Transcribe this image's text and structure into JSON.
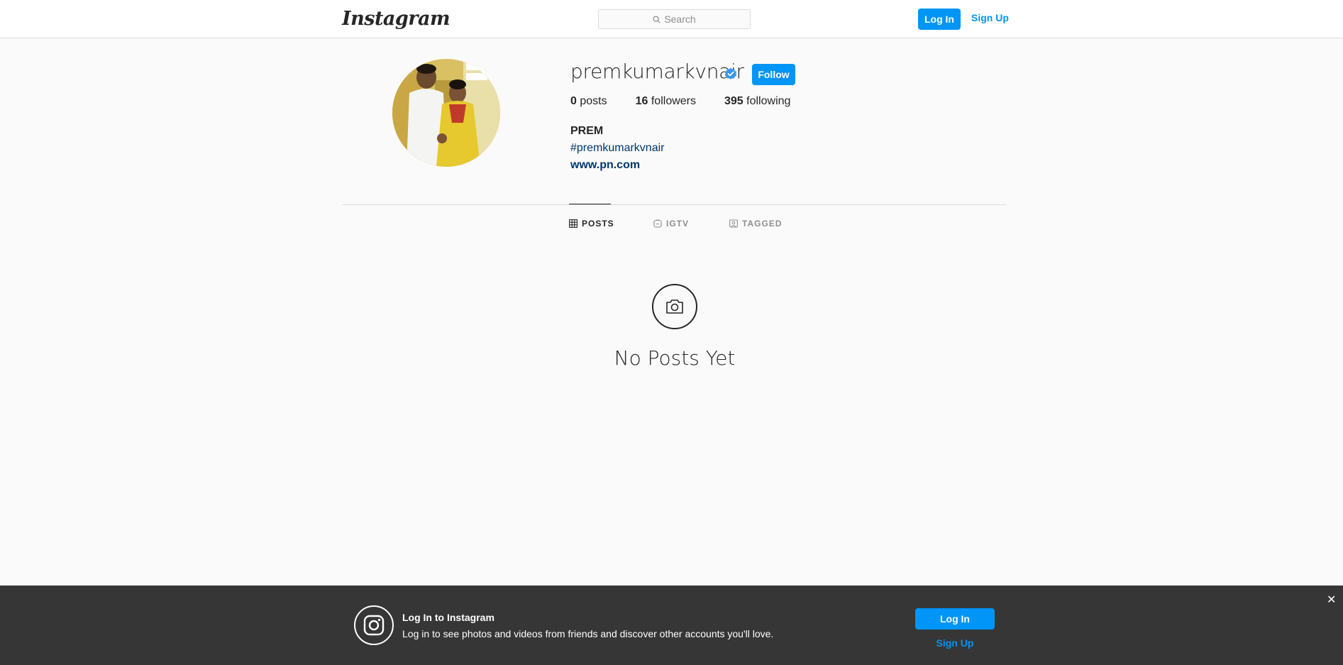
{
  "header": {
    "logo_text": "Instagram",
    "search_placeholder": "Search",
    "login_label": "Log In",
    "signup_label": "Sign Up"
  },
  "profile": {
    "username": "premkumarkvnair",
    "verified": true,
    "follow_label": "Follow",
    "stats": {
      "posts_count": "0",
      "posts_label": "posts",
      "followers_count": "16",
      "followers_label": "followers",
      "following_count": "395",
      "following_label": "following"
    },
    "full_name": "PREM",
    "bio_hashtag": "#premkumarkvnair",
    "website": "www.pn.com"
  },
  "tabs": [
    {
      "label": "POSTS",
      "icon": "grid-icon",
      "active": true
    },
    {
      "label": "IGTV",
      "icon": "igtv-icon",
      "active": false
    },
    {
      "label": "TAGGED",
      "icon": "tagged-icon",
      "active": false
    }
  ],
  "empty_state": {
    "icon": "camera-icon",
    "message": "No Posts Yet"
  },
  "login_banner": {
    "title": "Log In to Instagram",
    "text": "Log in to see photos and videos from friends and discover other accounts you'll love.",
    "login_label": "Log In",
    "signup_label": "Sign Up",
    "close_symbol": "✕"
  },
  "colors": {
    "accent": "#0095f6",
    "link_dark": "#00376b",
    "banner_bg": "#363636",
    "page_bg": "#fafafa"
  }
}
